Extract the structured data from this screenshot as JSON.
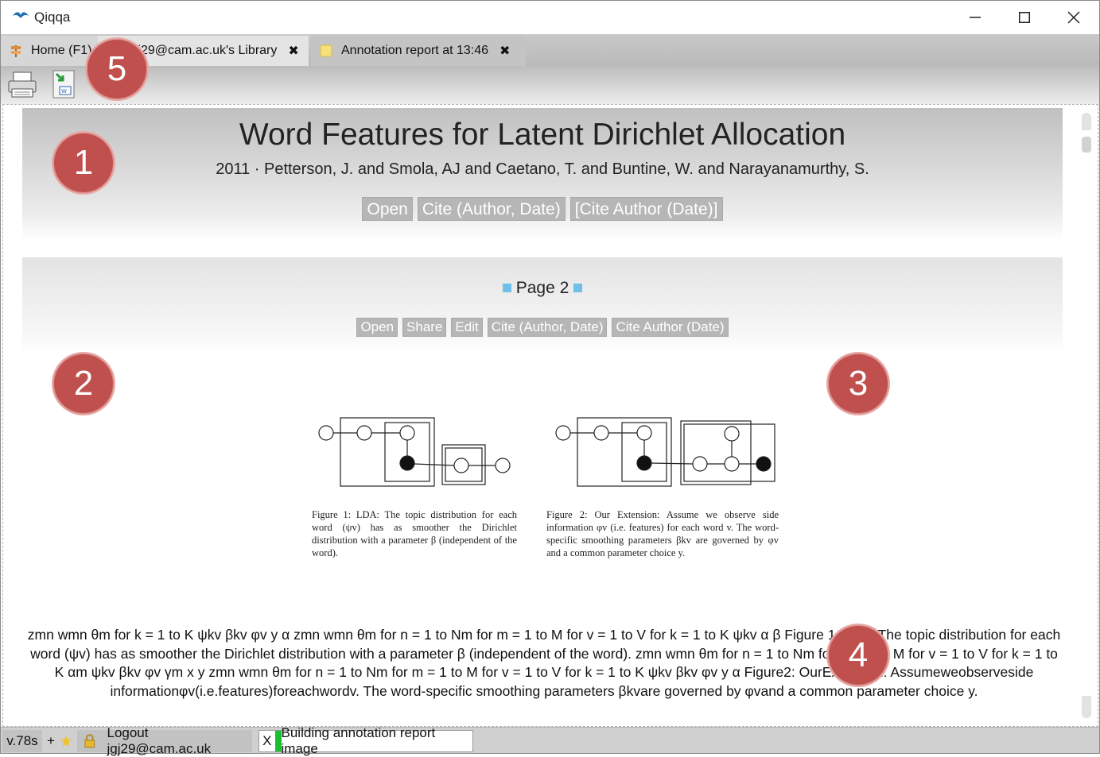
{
  "window": {
    "title": "Qiqqa",
    "controls": [
      "—",
      "☐",
      "✕"
    ]
  },
  "tabs": [
    {
      "label": "Home (F1)",
      "icon": "signpost-icon"
    },
    {
      "label": "jgj29@cam.ac.uk's Library",
      "close": "✖",
      "icon": "library-icon"
    },
    {
      "label": "Annotation report at 13:46",
      "close": "✖",
      "icon": "note-icon"
    }
  ],
  "toolbar": {
    "print_icon": "printer-icon",
    "export_icon": "export-word-icon"
  },
  "document": {
    "title": "Word Features for Latent Dirichlet Allocation",
    "meta": "2011 · Petterson, J. and Smola, AJ and Caetano, T. and Buntine, W. and Narayanamurthy, S.",
    "buttons": [
      "Open",
      "Cite (Author, Date)",
      "[Cite Author (Date)]"
    ]
  },
  "page": {
    "label": "Page 2",
    "buttons": [
      "Open",
      "Share",
      "Edit",
      "Cite (Author, Date)",
      "Cite Author (Date)"
    ]
  },
  "figure": {
    "caption1": "Figure 1: LDA: The topic distribution for each word (ψv) has as smoother the Dirichlet distribution with a parameter β (independent of the word).",
    "caption2": "Figure 2: Our Extension: Assume we observe side information φv (i.e. features) for each word v. The word-specific smoothing parameters βkv are governed by φv and a common parameter choice y."
  },
  "body_text": "zmn wmn θm for k = 1 to K ψkv βkv φv y α zmn wmn θm for n = 1 to Nm for m = 1 to M for v = 1 to V for k = 1 to K ψkv α β Figure 1: LDA: The topic distribution for each word (ψv) has as smoother the Dirichlet distribution with a parameter β (independent of the word). zmn wmn θm for n = 1 to Nm for m = 1 to M for v = 1 to V for k = 1 to K αm ψkv βkv φv γm x y zmn wmn θm for n = 1 to Nm for m = 1 to M for v = 1 to V for k = 1 to K ψkv βkv φv y α Figure2: OurExtension: Assumeweobserveside informationφv(i.e.features)foreachwordv. The word-specific smoothing parameters βkvare governed by φvand a common parameter choice y.",
  "badges": [
    "1",
    "2",
    "3",
    "4",
    "5"
  ],
  "status": {
    "version": "v.78s",
    "plus": "+",
    "logout": "Logout jgj29@cam.ac.uk",
    "task_x": "X",
    "task": "Building annotation report image"
  },
  "colors": {
    "badge": "#c0504d",
    "page_marker": "#6ec0e8",
    "progress": "#18c030",
    "button_bg": "#b6b6b6"
  }
}
